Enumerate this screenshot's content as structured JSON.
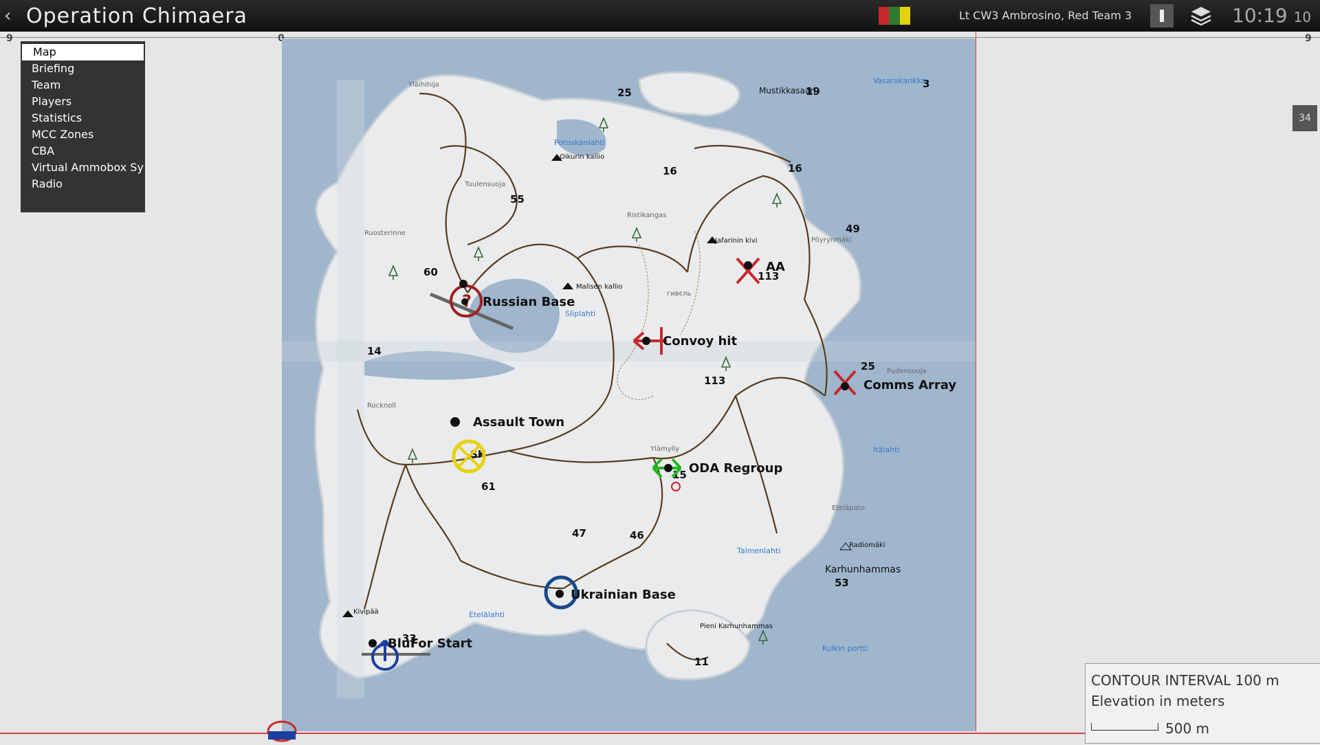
{
  "header": {
    "back_icon": "chevron-left-icon",
    "title": "Operation Chimaera",
    "faction_colors": [
      "#c8282d",
      "#2f7a2f",
      "#e6d20a"
    ],
    "player": "Lt CW3 Ambrosino, Red Team 3",
    "time_main": "10:19",
    "time_seconds": "10"
  },
  "grid": {
    "left_label": "9",
    "zero_label": "0",
    "right_label": "9"
  },
  "menu": {
    "items": [
      "Map",
      "Briefing",
      "Team",
      "Players",
      "Statistics",
      "MCC Zones",
      "CBA",
      "Virtual Ammobox Sy",
      "Radio"
    ],
    "selected": "Map"
  },
  "side_badge": "34",
  "markers": {
    "russian_base": "Russian Base",
    "convoy_hit": "Convoy hit",
    "aa": "AA",
    "comms_array": "Comms Array",
    "assault_town": "Assault Town",
    "oda_regroup": "ODA Regroup",
    "ukrainian_base": "Ukrainian Base",
    "blufor_start": "BluFor Start"
  },
  "places": {
    "mustikkasaari": "Mustikkasaari",
    "karhunhammas": "Karhunhammas",
    "kivipaa": "Kivipää",
    "etelalahti": "Etelälahti",
    "talmenlahti": "Talmenlahti",
    "itialahti": "Itälahti",
    "etelapato": "Eteläpato",
    "radiomaki": "Radiomäki",
    "pieni_karhunhammas": "Pieni Karhunhammas",
    "kulkin_portti": "Kulkin portti",
    "ylamylly": "Ylämylly",
    "pudensuoja": "Pudensuoja",
    "poyrynmaki": "Pöyrynmäki",
    "jafarinin_kivi": "Jafarinin kivi",
    "ristikangas": "Ristikangas",
    "malisen_kallio": "Malisen kallio",
    "sliplahti": "Sliplahti",
    "tuulensuoja": "Tuulensuoja",
    "ruosterinne": "Ruosterinne",
    "ylahihija": "Yläihihija",
    "potoskanlahti": "Potoskanlahti",
    "oikurin_kallio": "Oikurin kallio",
    "vasarakarikko": "Vasarakarikko",
    "rockhill": "Rocknoll",
    "town_sk": "SK",
    "giveb": "гивєль"
  },
  "heights": [
    "25",
    "19",
    "3",
    "16",
    "16",
    "55",
    "49",
    "60",
    "113",
    "14",
    "25",
    "113",
    "61",
    "15",
    "47",
    "46",
    "53",
    "33",
    "11"
  ],
  "legend": {
    "line1": "CONTOUR INTERVAL 100 m",
    "line2": "Elevation in meters",
    "scale": "500 m"
  },
  "colors": {
    "water": "#9fb6cd",
    "land": "#e9ebec",
    "road": "#5a3a1a",
    "enemy": "#c8282d",
    "friendly": "#1a3fa0",
    "objective": "#e6d20a",
    "regroup": "#22b822"
  }
}
